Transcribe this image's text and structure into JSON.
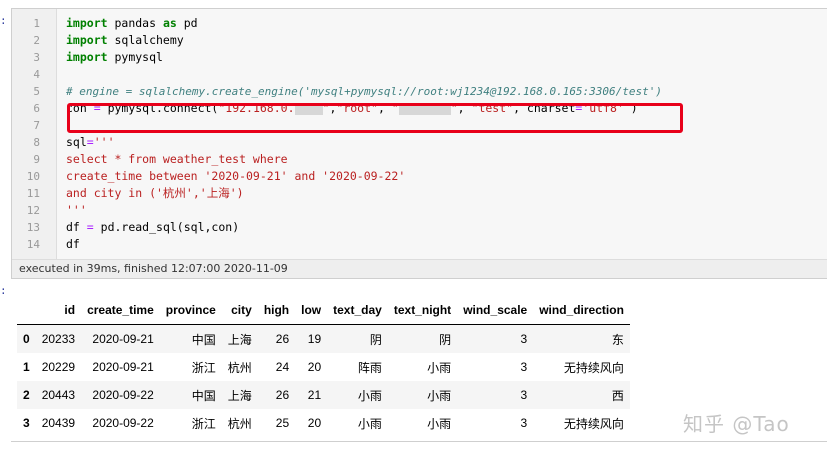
{
  "input_prompt": ":",
  "output_prompt": ":",
  "line_numbers": [
    "1",
    "2",
    "3",
    "4",
    "5",
    "6",
    "7",
    "8",
    "9",
    "10",
    "11",
    "12",
    "13",
    "14"
  ],
  "code": {
    "l1": {
      "kw": "import",
      "rest": " pandas ",
      "kw2": "as",
      "rest2": " pd"
    },
    "l2": {
      "kw": "import",
      "rest": " sqlalchemy"
    },
    "l3": {
      "kw": "import",
      "rest": " pymysql"
    },
    "l5": "# engine = sqlalchemy.create_engine('mysql+pymysql://root:wj1234@192.168.0.165:3306/test')",
    "l6": {
      "var": "con ",
      "op": "=",
      "call": " pymysql.connect(",
      "s1": "\"192.168.0.",
      "s1b": "\"",
      "comma1": ",",
      "s2": "\"root\"",
      "comma2": ", ",
      "s3a": "\"",
      "s3b": "\"",
      "comma3": ", ",
      "s4": "\"test\"",
      "comma4": ", charset",
      "op2": "=",
      "s5": "'utf8'",
      "close": " )"
    },
    "l8": {
      "var": "sql",
      "op": "=",
      "str": "'''"
    },
    "l9": "select * from weather_test where",
    "l10": "create_time between '2020-09-21' and '2020-09-22'",
    "l11": "and city in ('杭州','上海')",
    "l12": "'''",
    "l13": {
      "var": "df ",
      "op": "=",
      "rest": " pd.read_sql(sql,con)"
    },
    "l14": "df"
  },
  "exec_status": "executed in 39ms, finished 12:07:00 2020-11-09",
  "table": {
    "columns": [
      "",
      "id",
      "create_time",
      "province",
      "city",
      "high",
      "low",
      "text_day",
      "text_night",
      "wind_scale",
      "wind_direction"
    ],
    "rows": [
      {
        "index": "0",
        "cells": [
          "20233",
          "2020-09-21",
          "中国",
          "上海",
          "26",
          "19",
          "阴",
          "阴",
          "3",
          "东"
        ]
      },
      {
        "index": "1",
        "cells": [
          "20229",
          "2020-09-21",
          "浙江",
          "杭州",
          "24",
          "20",
          "阵雨",
          "小雨",
          "3",
          "无持续风向"
        ]
      },
      {
        "index": "2",
        "cells": [
          "20443",
          "2020-09-22",
          "中国",
          "上海",
          "26",
          "21",
          "小雨",
          "小雨",
          "3",
          "西"
        ]
      },
      {
        "index": "3",
        "cells": [
          "20439",
          "2020-09-22",
          "浙江",
          "杭州",
          "25",
          "20",
          "小雨",
          "小雨",
          "3",
          "无持续风向"
        ]
      }
    ]
  },
  "watermark": "知乎 @Tao",
  "colors": {
    "highlight_box": "#e8001a",
    "keyword": "#008000",
    "string": "#ba2121",
    "comment": "#408080"
  }
}
